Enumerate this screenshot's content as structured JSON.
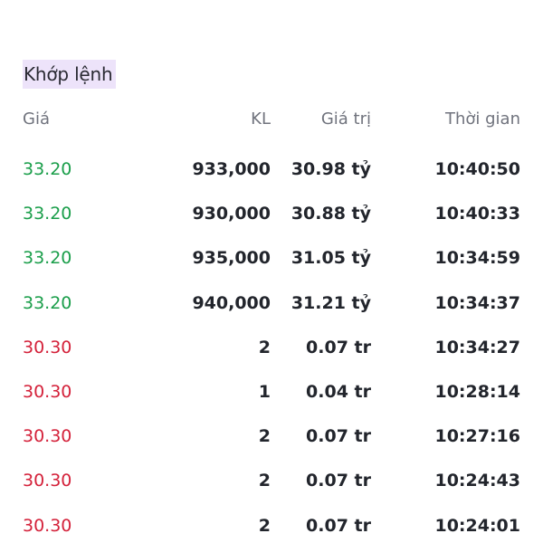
{
  "title": "Khớp lệnh",
  "headers": {
    "price": "Giá",
    "volume": "KL",
    "value": "Giá trị",
    "time": "Thời gian"
  },
  "colors": {
    "up": "#1a9e4a",
    "down": "#d4213a",
    "title_bg": "#ede3fa"
  },
  "rows": [
    {
      "price": "33.20",
      "volume": "933,000",
      "value": "30.98 tỷ",
      "time": "10:40:50",
      "direction": "up"
    },
    {
      "price": "33.20",
      "volume": "930,000",
      "value": "30.88 tỷ",
      "time": "10:40:33",
      "direction": "up"
    },
    {
      "price": "33.20",
      "volume": "935,000",
      "value": "31.05 tỷ",
      "time": "10:34:59",
      "direction": "up"
    },
    {
      "price": "33.20",
      "volume": "940,000",
      "value": "31.21 tỷ",
      "time": "10:34:37",
      "direction": "up"
    },
    {
      "price": "30.30",
      "volume": "2",
      "value": "0.07 tr",
      "time": "10:34:27",
      "direction": "down"
    },
    {
      "price": "30.30",
      "volume": "1",
      "value": "0.04 tr",
      "time": "10:28:14",
      "direction": "down"
    },
    {
      "price": "30.30",
      "volume": "2",
      "value": "0.07 tr",
      "time": "10:27:16",
      "direction": "down"
    },
    {
      "price": "30.30",
      "volume": "2",
      "value": "0.07 tr",
      "time": "10:24:43",
      "direction": "down"
    },
    {
      "price": "30.30",
      "volume": "2",
      "value": "0.07 tr",
      "time": "10:24:01",
      "direction": "down"
    }
  ]
}
